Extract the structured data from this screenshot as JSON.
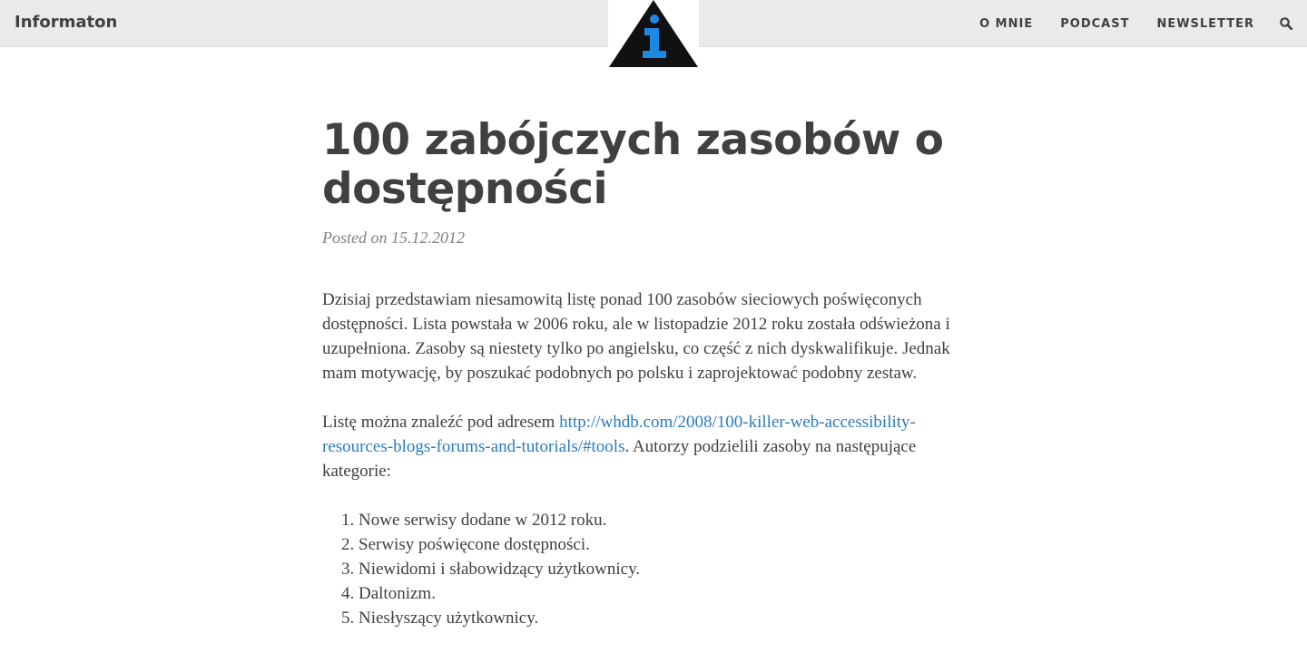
{
  "site": {
    "brand": "Informaton"
  },
  "nav": {
    "items": [
      "O MNIE",
      "PODCAST",
      "NEWSLETTER"
    ],
    "search_icon": "search-icon"
  },
  "logo": {
    "icon": "info-triangle-icon",
    "colors": {
      "triangle": "#111111",
      "glyph": "#1e88e5"
    }
  },
  "post": {
    "title": "100 zabójczych zasobów o dostępności",
    "meta": "Posted on 15.12.2012",
    "paragraph1": "Dzisiaj przedstawiam niesamowitą listę ponad 100 zasobów sieciowych poświęconych dostępności. Lista powstała w 2006 roku, ale w listopadzie 2012 roku została odświeżona i uzupełniona. Zasoby są niestety tylko po angielsku, co część z nich dyskwalifikuje. Jednak mam motywację, by poszukać podobnych po polsku i zaprojektować podobny zestaw.",
    "paragraph2_before": "Listę można znaleźć pod adresem ",
    "paragraph2_link": "http://whdb.com/2008/100-killer-web-accessibility-resources-blogs-forums-and-tutorials/#tools",
    "paragraph2_after": ". Autorzy podzielili zasoby na następujące kategorie:",
    "categories": [
      "Nowe serwisy dodane w 2012 roku.",
      "Serwisy poświęcone dostępności.",
      "Niewidomi i słabowidzący użytkownicy.",
      "Daltonizm.",
      "Niesłyszący użytkownicy."
    ]
  },
  "colors": {
    "navbar_bg": "#eaeaea",
    "text": "#404040",
    "link": "#2a7bc0",
    "meta": "#808080"
  }
}
